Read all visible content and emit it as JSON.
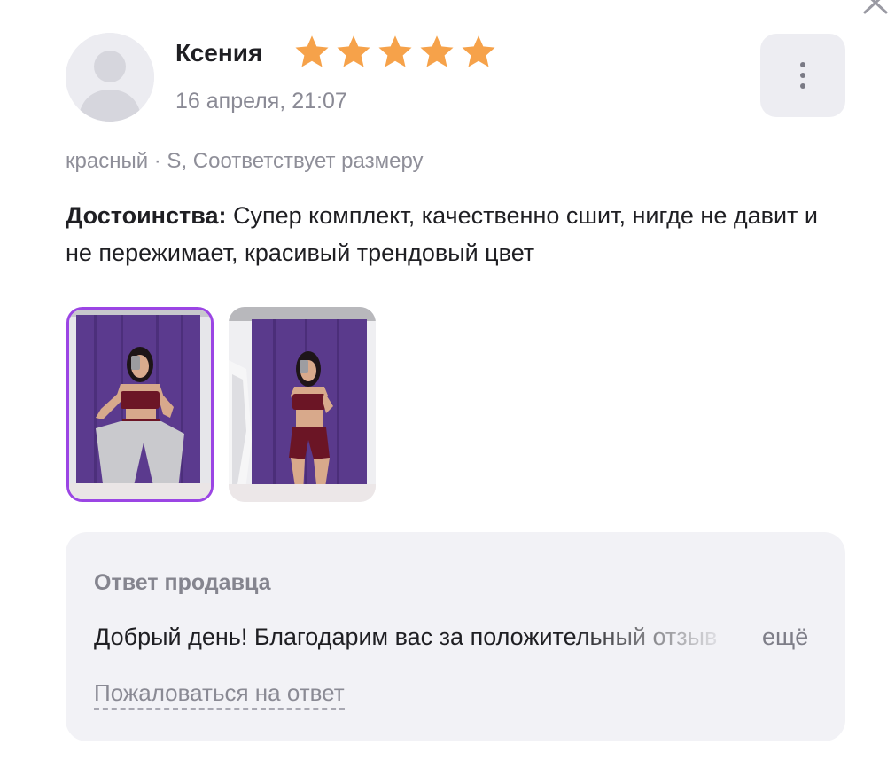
{
  "review": {
    "author": "Ксения",
    "rating": 5,
    "rating_max": 5,
    "date": "16 апреля, 21:07",
    "variant": "красный · S, Соответствует размеру",
    "pros_label": "Достоинства:",
    "pros_text": " Супер комплект, качественно сшит, нигде не давит и не пережимает, красивый трендовый цвет",
    "photos_count": 2
  },
  "seller_reply": {
    "title": "Ответ продавца",
    "text": "Добрый день! Благодарим вас за положительный отзыв",
    "more_label": "ещё",
    "complain_label": "Пожаловаться на ответ"
  },
  "colors": {
    "star": "#f6a24a",
    "photo_selected_border": "#9b45e4",
    "panel_bg": "#f2f2f6",
    "muted_text": "#8a8a95"
  },
  "icons": {
    "close": "close-icon",
    "more": "more-vertical-icon",
    "avatar": "user-avatar-icon",
    "star": "star-icon"
  }
}
